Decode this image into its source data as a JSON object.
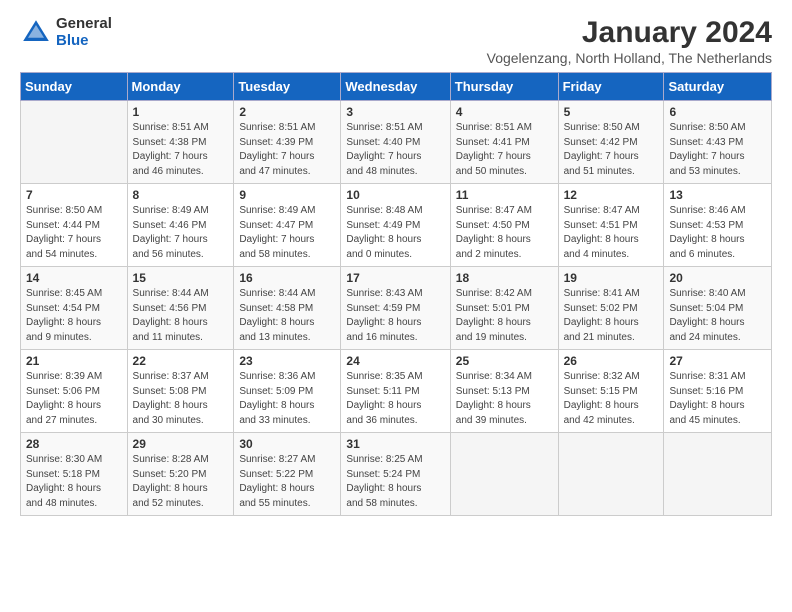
{
  "header": {
    "logo_general": "General",
    "logo_blue": "Blue",
    "month_title": "January 2024",
    "location": "Vogelenzang, North Holland, The Netherlands"
  },
  "days_of_week": [
    "Sunday",
    "Monday",
    "Tuesday",
    "Wednesday",
    "Thursday",
    "Friday",
    "Saturday"
  ],
  "weeks": [
    [
      {
        "num": "",
        "info": ""
      },
      {
        "num": "1",
        "info": "Sunrise: 8:51 AM\nSunset: 4:38 PM\nDaylight: 7 hours\nand 46 minutes."
      },
      {
        "num": "2",
        "info": "Sunrise: 8:51 AM\nSunset: 4:39 PM\nDaylight: 7 hours\nand 47 minutes."
      },
      {
        "num": "3",
        "info": "Sunrise: 8:51 AM\nSunset: 4:40 PM\nDaylight: 7 hours\nand 48 minutes."
      },
      {
        "num": "4",
        "info": "Sunrise: 8:51 AM\nSunset: 4:41 PM\nDaylight: 7 hours\nand 50 minutes."
      },
      {
        "num": "5",
        "info": "Sunrise: 8:50 AM\nSunset: 4:42 PM\nDaylight: 7 hours\nand 51 minutes."
      },
      {
        "num": "6",
        "info": "Sunrise: 8:50 AM\nSunset: 4:43 PM\nDaylight: 7 hours\nand 53 minutes."
      }
    ],
    [
      {
        "num": "7",
        "info": "Sunrise: 8:50 AM\nSunset: 4:44 PM\nDaylight: 7 hours\nand 54 minutes."
      },
      {
        "num": "8",
        "info": "Sunrise: 8:49 AM\nSunset: 4:46 PM\nDaylight: 7 hours\nand 56 minutes."
      },
      {
        "num": "9",
        "info": "Sunrise: 8:49 AM\nSunset: 4:47 PM\nDaylight: 7 hours\nand 58 minutes."
      },
      {
        "num": "10",
        "info": "Sunrise: 8:48 AM\nSunset: 4:49 PM\nDaylight: 8 hours\nand 0 minutes."
      },
      {
        "num": "11",
        "info": "Sunrise: 8:47 AM\nSunset: 4:50 PM\nDaylight: 8 hours\nand 2 minutes."
      },
      {
        "num": "12",
        "info": "Sunrise: 8:47 AM\nSunset: 4:51 PM\nDaylight: 8 hours\nand 4 minutes."
      },
      {
        "num": "13",
        "info": "Sunrise: 8:46 AM\nSunset: 4:53 PM\nDaylight: 8 hours\nand 6 minutes."
      }
    ],
    [
      {
        "num": "14",
        "info": "Sunrise: 8:45 AM\nSunset: 4:54 PM\nDaylight: 8 hours\nand 9 minutes."
      },
      {
        "num": "15",
        "info": "Sunrise: 8:44 AM\nSunset: 4:56 PM\nDaylight: 8 hours\nand 11 minutes."
      },
      {
        "num": "16",
        "info": "Sunrise: 8:44 AM\nSunset: 4:58 PM\nDaylight: 8 hours\nand 13 minutes."
      },
      {
        "num": "17",
        "info": "Sunrise: 8:43 AM\nSunset: 4:59 PM\nDaylight: 8 hours\nand 16 minutes."
      },
      {
        "num": "18",
        "info": "Sunrise: 8:42 AM\nSunset: 5:01 PM\nDaylight: 8 hours\nand 19 minutes."
      },
      {
        "num": "19",
        "info": "Sunrise: 8:41 AM\nSunset: 5:02 PM\nDaylight: 8 hours\nand 21 minutes."
      },
      {
        "num": "20",
        "info": "Sunrise: 8:40 AM\nSunset: 5:04 PM\nDaylight: 8 hours\nand 24 minutes."
      }
    ],
    [
      {
        "num": "21",
        "info": "Sunrise: 8:39 AM\nSunset: 5:06 PM\nDaylight: 8 hours\nand 27 minutes."
      },
      {
        "num": "22",
        "info": "Sunrise: 8:37 AM\nSunset: 5:08 PM\nDaylight: 8 hours\nand 30 minutes."
      },
      {
        "num": "23",
        "info": "Sunrise: 8:36 AM\nSunset: 5:09 PM\nDaylight: 8 hours\nand 33 minutes."
      },
      {
        "num": "24",
        "info": "Sunrise: 8:35 AM\nSunset: 5:11 PM\nDaylight: 8 hours\nand 36 minutes."
      },
      {
        "num": "25",
        "info": "Sunrise: 8:34 AM\nSunset: 5:13 PM\nDaylight: 8 hours\nand 39 minutes."
      },
      {
        "num": "26",
        "info": "Sunrise: 8:32 AM\nSunset: 5:15 PM\nDaylight: 8 hours\nand 42 minutes."
      },
      {
        "num": "27",
        "info": "Sunrise: 8:31 AM\nSunset: 5:16 PM\nDaylight: 8 hours\nand 45 minutes."
      }
    ],
    [
      {
        "num": "28",
        "info": "Sunrise: 8:30 AM\nSunset: 5:18 PM\nDaylight: 8 hours\nand 48 minutes."
      },
      {
        "num": "29",
        "info": "Sunrise: 8:28 AM\nSunset: 5:20 PM\nDaylight: 8 hours\nand 52 minutes."
      },
      {
        "num": "30",
        "info": "Sunrise: 8:27 AM\nSunset: 5:22 PM\nDaylight: 8 hours\nand 55 minutes."
      },
      {
        "num": "31",
        "info": "Sunrise: 8:25 AM\nSunset: 5:24 PM\nDaylight: 8 hours\nand 58 minutes."
      },
      {
        "num": "",
        "info": ""
      },
      {
        "num": "",
        "info": ""
      },
      {
        "num": "",
        "info": ""
      }
    ]
  ]
}
